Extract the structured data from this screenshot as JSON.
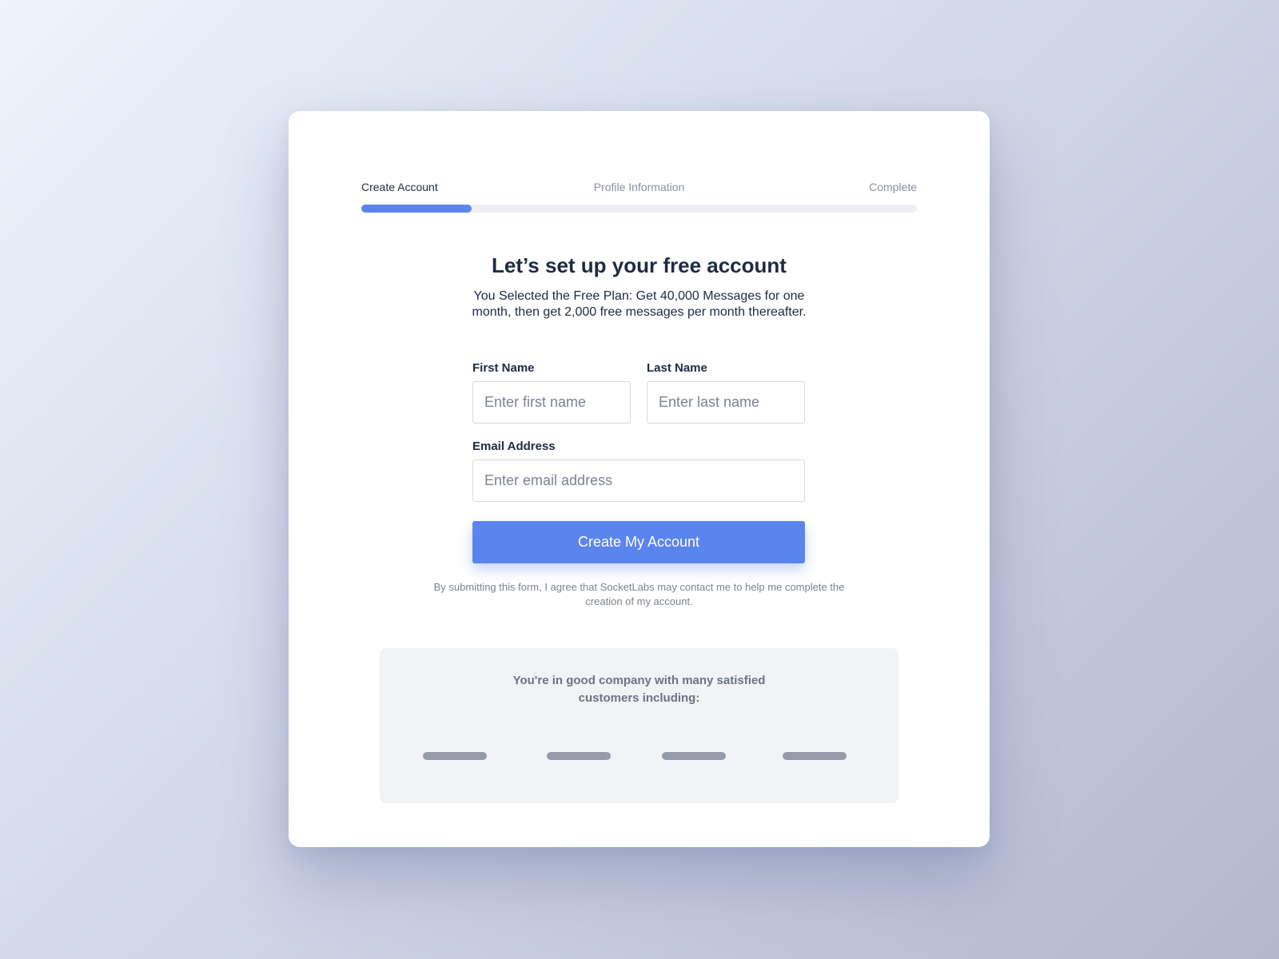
{
  "progress": {
    "steps": [
      {
        "label": "Create Account",
        "active": true
      },
      {
        "label": "Profile Information",
        "active": false
      },
      {
        "label": "Complete",
        "active": false
      }
    ],
    "fraction": 0.198
  },
  "header": {
    "title": "Let’s set up your free account",
    "subtitle": "You Selected the Free Plan: Get 40,000 Messages for one month, then get 2,000 free messages per month thereafter."
  },
  "form": {
    "first_name": {
      "label": "First Name",
      "placeholder": "Enter first name",
      "value": ""
    },
    "last_name": {
      "label": "Last Name",
      "placeholder": "Enter last name",
      "value": ""
    },
    "email": {
      "label": "Email Address",
      "placeholder": "Enter email address",
      "value": ""
    },
    "submit_label": "Create My Account",
    "disclaimer": "By submitting this form, I agree that SocketLabs may contact me to help me complete the creation of my account."
  },
  "customers": {
    "heading": "You're in good company with many satisfied customers including:",
    "logos": [
      "logo-placeholder",
      "logo-placeholder",
      "logo-placeholder",
      "logo-placeholder"
    ]
  },
  "colors": {
    "accent": "#5b84ee",
    "text_dark": "#1f2a44",
    "text_muted": "#7c8291",
    "panel_bg": "#f1f3f6",
    "logo_placeholder": "#959baa"
  }
}
